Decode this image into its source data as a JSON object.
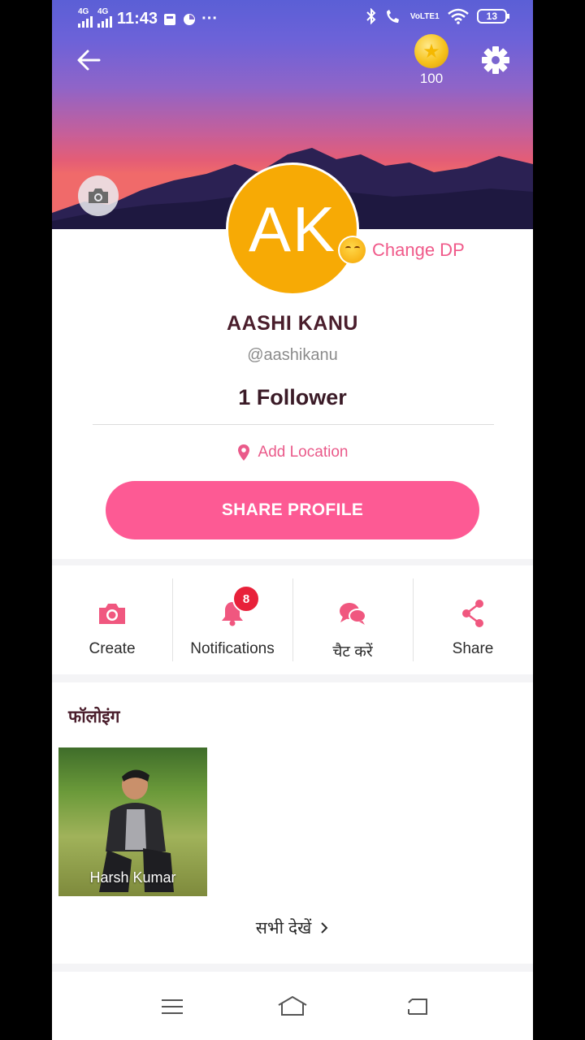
{
  "status_bar": {
    "network1": "4G",
    "network2": "4G",
    "time": "11:43",
    "dots": "···",
    "volte": "VoLTE1",
    "battery": "13"
  },
  "header": {
    "coins": "100"
  },
  "profile": {
    "initials": "AK",
    "change_dp": "Change DP",
    "name": "AASHI KANU",
    "handle": "@aashikanu",
    "followers": "1 Follower",
    "add_location": "Add Location",
    "share_profile": "SHARE PROFILE",
    "avatar_color": "#f7aa05",
    "accent_color": "#fd5a94"
  },
  "actions": [
    {
      "label": "Create",
      "icon": "camera-icon"
    },
    {
      "label": "Notifications",
      "icon": "bell-icon",
      "badge": "8"
    },
    {
      "label": "चैट करें",
      "icon": "chat-icon"
    },
    {
      "label": "Share",
      "icon": "share-icon"
    }
  ],
  "following": {
    "title": "फॉलोइंग",
    "items": [
      {
        "name": "Harsh Kumar"
      }
    ],
    "see_all": "सभी देखें"
  },
  "nav": {
    "menu_icon": "menu-icon",
    "home_icon": "home-icon",
    "back_icon": "back-icon"
  }
}
